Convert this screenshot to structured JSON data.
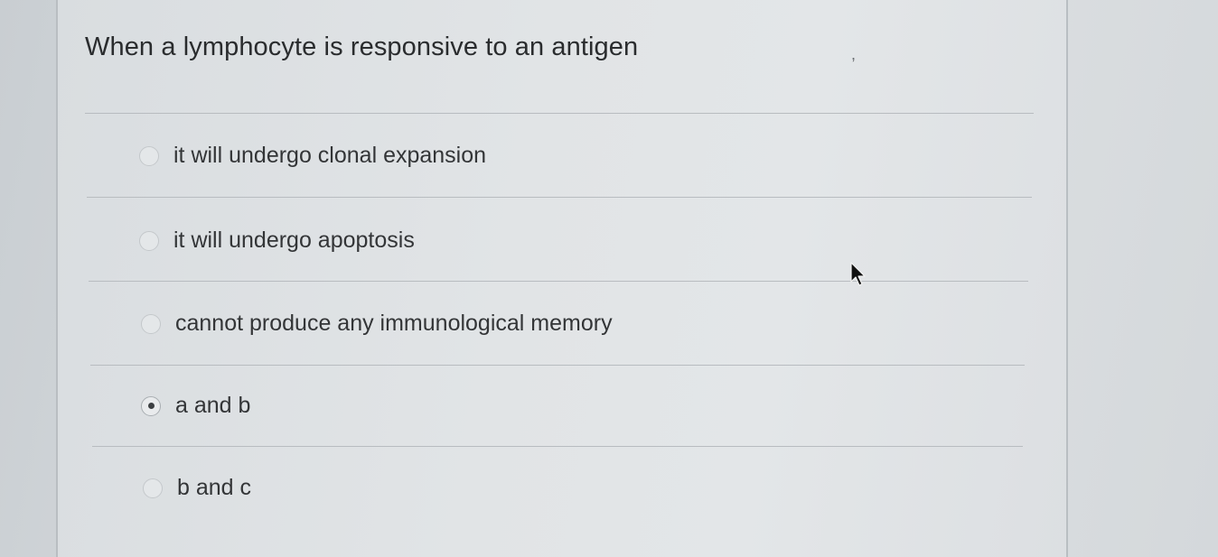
{
  "question": {
    "text": "When a lymphocyte is responsive to an antigen",
    "stray_mark": ","
  },
  "options": [
    {
      "label": "it will undergo clonal expansion",
      "selected": false
    },
    {
      "label": "it will undergo apoptosis",
      "selected": false
    },
    {
      "label": "cannot produce any immunological memory",
      "selected": false
    },
    {
      "label": "a and b",
      "selected": true
    },
    {
      "label": "b and c",
      "selected": false
    }
  ],
  "colors": {
    "text": "#2a2c2e",
    "divider": "#b8bcc0",
    "radio_dot": "#3c3f42"
  },
  "icons": {
    "cursor": "mouse-pointer-icon"
  }
}
